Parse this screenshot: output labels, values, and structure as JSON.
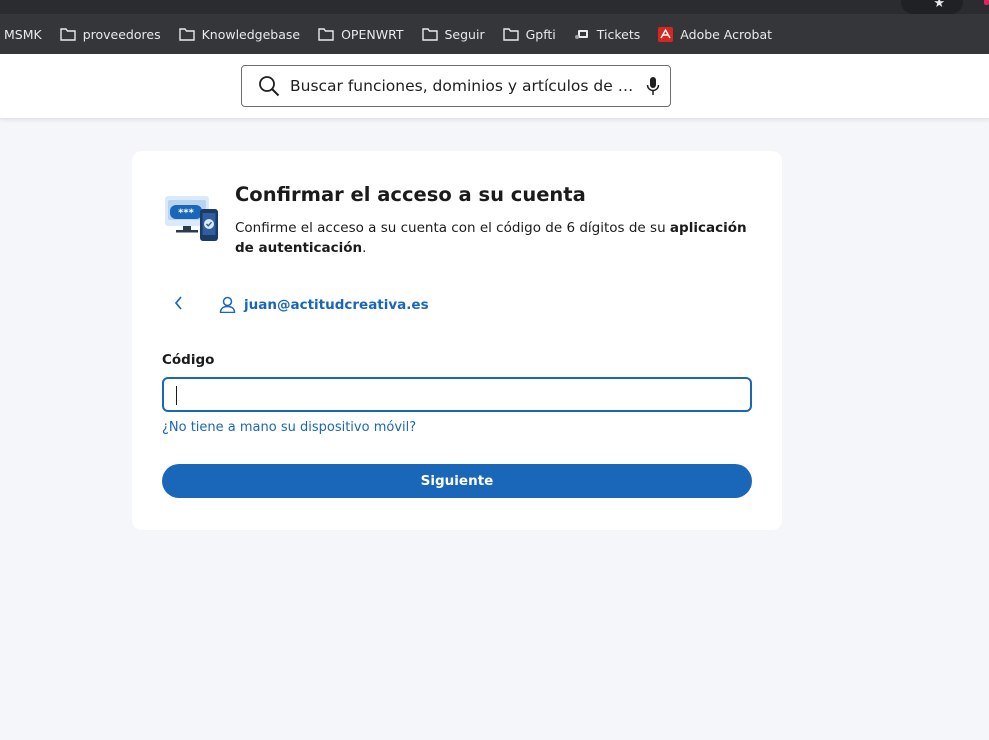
{
  "bookmarks": [
    {
      "label": "MSMK",
      "icon": "none"
    },
    {
      "label": "proveedores",
      "icon": "folder-icon"
    },
    {
      "label": "Knowledgebase",
      "icon": "folder-icon"
    },
    {
      "label": "OPENWRT",
      "icon": "folder-icon"
    },
    {
      "label": "Seguir",
      "icon": "folder-icon"
    },
    {
      "label": "Gpfti",
      "icon": "folder-icon"
    },
    {
      "label": "Tickets",
      "icon": "ticket-favicon"
    },
    {
      "label": "Adobe Acrobat",
      "icon": "acrobat-icon"
    }
  ],
  "search": {
    "placeholder": "Buscar funciones, dominios y artículos de ay..."
  },
  "card": {
    "title": "Confirmar el acceso a su cuenta",
    "description_pre": "Confirme el acceso a su cuenta con el código de 6 dígitos de su ",
    "description_bold": "aplicación de autenticación",
    "description_post": ".",
    "account_email": "juan@actitudcreativa.es",
    "code_label": "Código",
    "code_value": "",
    "no_device_link": "¿No tiene a mano su dispositivo móvil?",
    "next_button": "Siguiente"
  },
  "colors": {
    "accent": "#1a66b8",
    "page_bg": "#f4f6f9",
    "bookmarks_bar": "#35363a"
  }
}
